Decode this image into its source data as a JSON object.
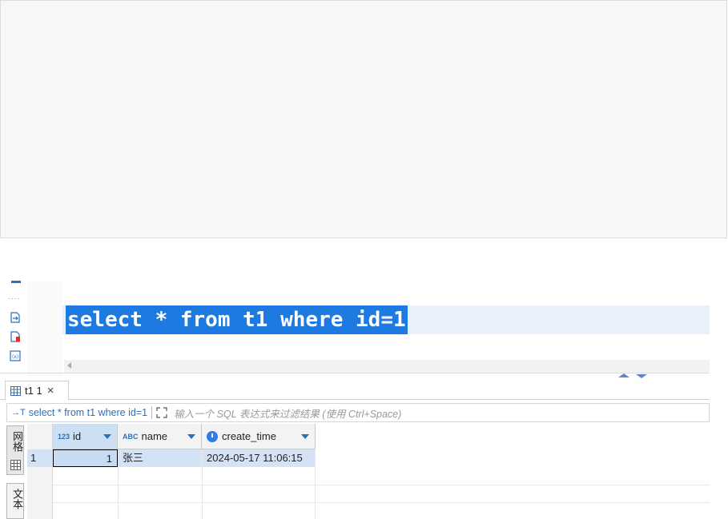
{
  "sql_editor": {
    "query_text": "select * from t1 where id=1",
    "gutter_dots": "....",
    "icons": [
      "export-icon",
      "warning-file-icon",
      "variables-icon"
    ]
  },
  "result_tab": {
    "label": "t1 1",
    "close_glyph": "×"
  },
  "filter_bar": {
    "query_icon": "→T",
    "query_text": "select * from t1 where id=1",
    "placeholder": "输入一个 SQL 表达式来过滤结果 (使用 Ctrl+Space)"
  },
  "side_tabs": {
    "grid_label": "网格",
    "text_label": "文本"
  },
  "grid": {
    "columns": [
      {
        "name": "id",
        "type_badge": "123"
      },
      {
        "name": "name",
        "type_badge": "ABC"
      },
      {
        "name": "create_time",
        "type_badge": "clock"
      }
    ],
    "rows": [
      {
        "row_number": "1",
        "id": "1",
        "name": "张三",
        "create_time": "2024-05-17 11:06:15"
      }
    ]
  },
  "colors": {
    "selection": "#1d7ae0",
    "accent": "#2d6fbd",
    "row_highlight": "#d3e3f5"
  }
}
